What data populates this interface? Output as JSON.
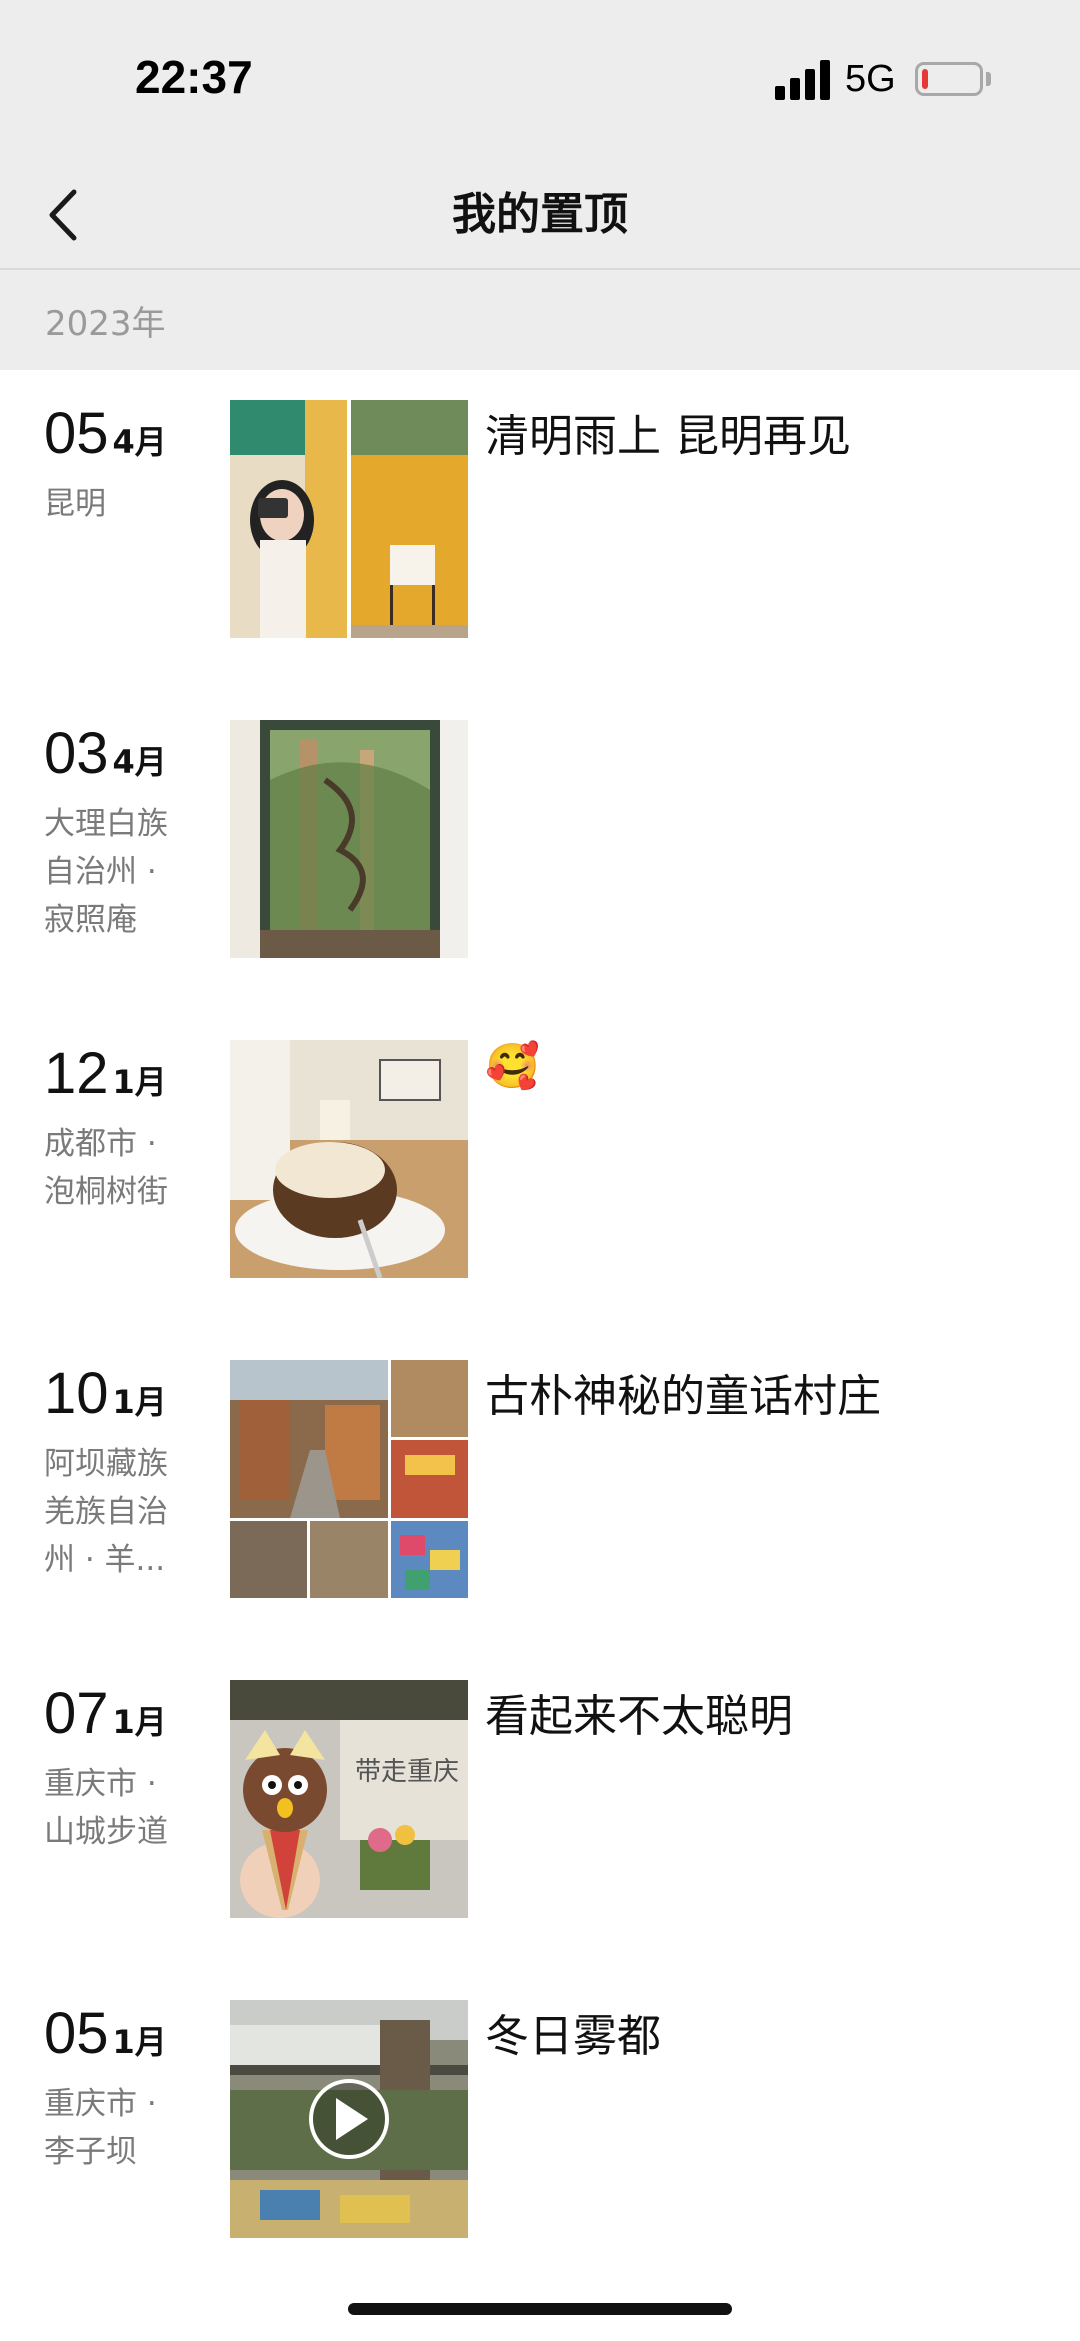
{
  "status": {
    "time": "22:37",
    "network": "5G"
  },
  "nav": {
    "title": "我的置顶"
  },
  "year": "2023年",
  "posts": [
    {
      "day": "05",
      "month": "4月",
      "location": "昆明",
      "text": "清明雨上 昆明再见"
    },
    {
      "day": "03",
      "month": "4月",
      "location": "大理白族自治州 · 寂照庵",
      "text": ""
    },
    {
      "day": "12",
      "month": "1月",
      "location": "成都市 · 泡桐树街",
      "text": "🥰"
    },
    {
      "day": "10",
      "month": "1月",
      "location": "阿坝藏族羌族自治州 · 羊...",
      "text": "古朴神秘的童话村庄"
    },
    {
      "day": "07",
      "month": "1月",
      "location": "重庆市 · 山城步道",
      "text": "看起来不太聪明"
    },
    {
      "day": "05",
      "month": "1月",
      "location": "重庆市 · 李子坝",
      "text": "冬日雾都"
    }
  ],
  "thumb_sign": "带走重庆",
  "colors": {
    "nav_bg": "#ededed",
    "battery_low": "#e53935",
    "secondary_text": "#7a7a7a"
  }
}
